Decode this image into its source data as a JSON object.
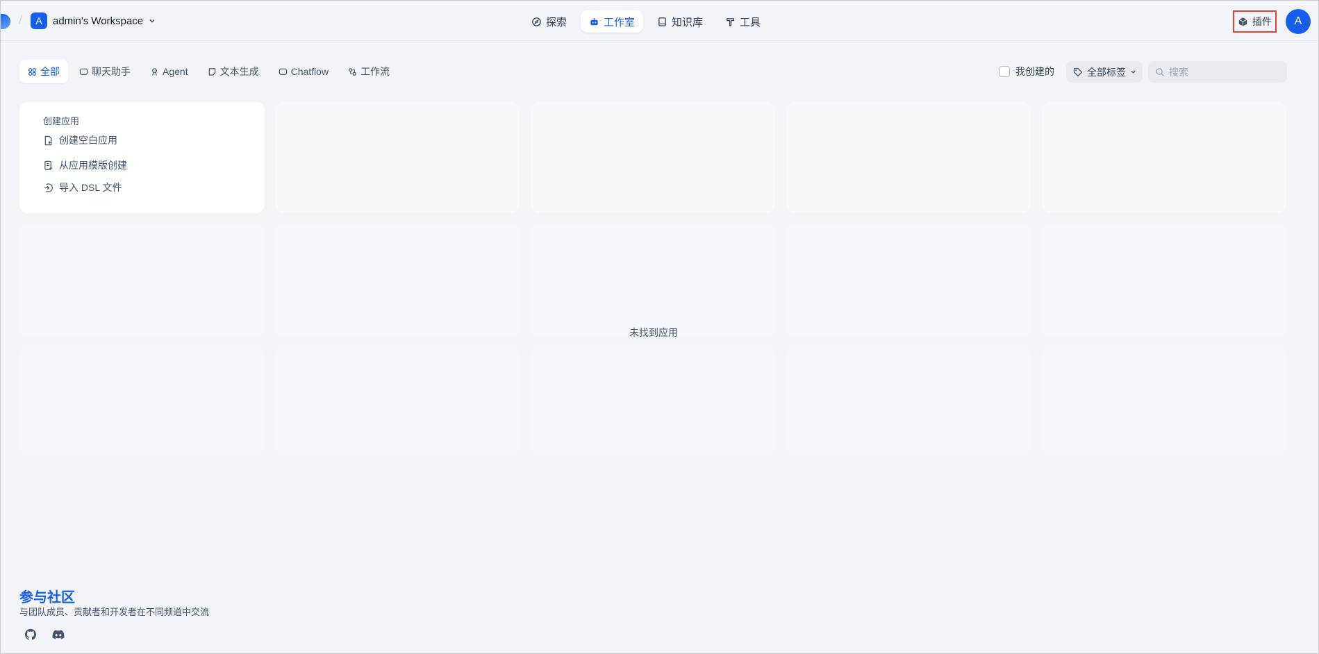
{
  "header": {
    "workspace_initial": "A",
    "workspace_name": "admin's Workspace",
    "nav": {
      "explore": "探索",
      "studio": "工作室",
      "knowledge": "知识库",
      "tools": "工具"
    },
    "plugin_label": "插件",
    "user_initial": "A"
  },
  "filters": {
    "tabs": {
      "all": "全部",
      "chat": "聊天助手",
      "agent": "Agent",
      "completion": "文本生成",
      "chatflow": "Chatflow",
      "workflow": "工作流"
    },
    "created_by_me": "我创建的",
    "tags_label": "全部标签",
    "search_placeholder": "搜索"
  },
  "create_card": {
    "title": "创建应用",
    "blank": "创建空白应用",
    "from_template": "从应用模版创建",
    "import_dsl": "导入 DSL 文件"
  },
  "empty_state": "未找到应用",
  "footer": {
    "title": "参与社区",
    "subtitle": "与团队成员、贡献者和开发者在不同频道中交流",
    "social_icons": [
      "github-icon",
      "discord-icon"
    ]
  },
  "colors": {
    "accent": "#155eef",
    "highlight_border": "#e0452b",
    "background": "#f2f4f7"
  }
}
